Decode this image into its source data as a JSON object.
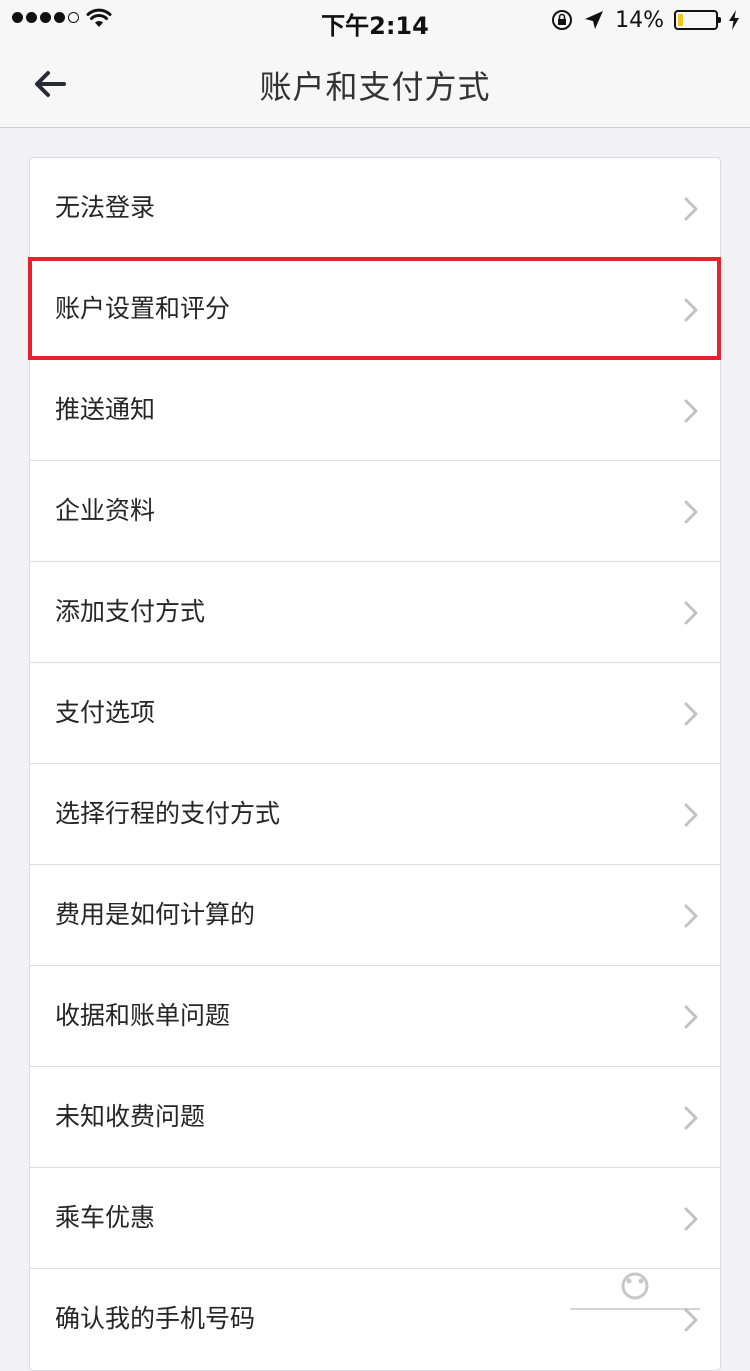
{
  "status_bar": {
    "time": "下午2:14",
    "battery_percent": "14%",
    "battery_level": 0.14,
    "icons": [
      "signal-dots",
      "wifi-icon",
      "rotation-lock-icon",
      "location-arrow-icon",
      "battery-icon",
      "charging-icon"
    ]
  },
  "nav": {
    "title": "账户和支付方式",
    "back_icon": "back-arrow-icon"
  },
  "menu": {
    "items": [
      {
        "label": "无法登录"
      },
      {
        "label": "账户设置和评分",
        "highlighted": true
      },
      {
        "label": "推送通知"
      },
      {
        "label": "企业资料"
      },
      {
        "label": "添加支付方式"
      },
      {
        "label": "支付选项"
      },
      {
        "label": "选择行程的支付方式"
      },
      {
        "label": "费用是如何计算的"
      },
      {
        "label": "收据和账单问题"
      },
      {
        "label": "未知收费问题"
      },
      {
        "label": "乘车优惠"
      },
      {
        "label": "确认我的手机号码"
      }
    ],
    "chevron_icon": "chevron-right-icon"
  },
  "colors": {
    "highlight": "#e8212f",
    "battery_fill": "#f5c518",
    "background": "#f2f2f4"
  }
}
